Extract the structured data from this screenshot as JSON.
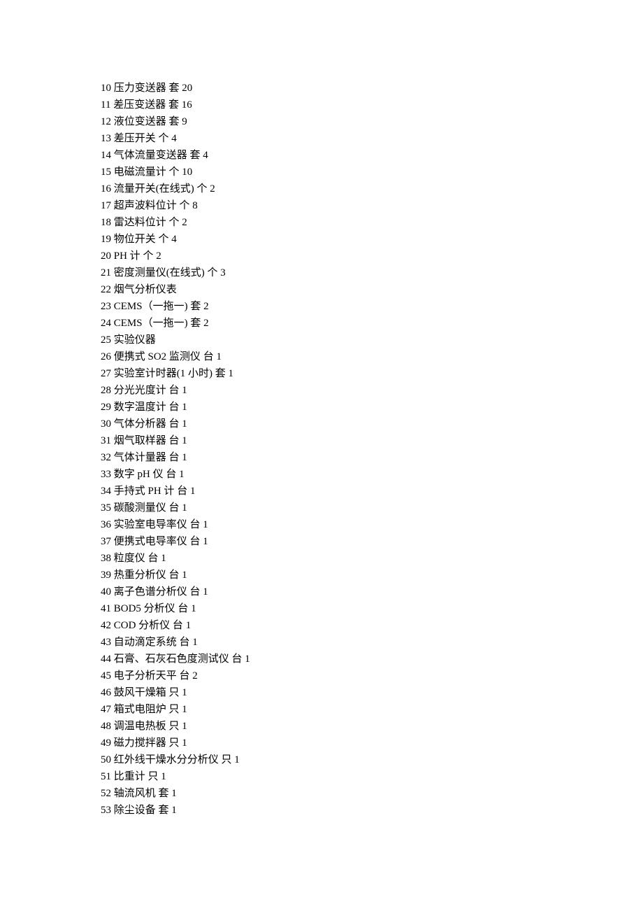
{
  "items": [
    {
      "num": "10",
      "name": "压力变送器",
      "unit": "套",
      "qty": "20"
    },
    {
      "num": "11",
      "name": "差压变送器",
      "unit": "套",
      "qty": "16"
    },
    {
      "num": "12",
      "name": "液位变送器",
      "unit": "套",
      "qty": "9"
    },
    {
      "num": "13",
      "name": "差压开关",
      "unit": "个",
      "qty": "4"
    },
    {
      "num": "14",
      "name": "气体流量变送器",
      "unit": "套",
      "qty": "4"
    },
    {
      "num": "15",
      "name": "电磁流量计",
      "unit": "个",
      "qty": "10"
    },
    {
      "num": "16",
      "name": "流量开关(在线式)",
      "unit": "个",
      "qty": "2"
    },
    {
      "num": "17",
      "name": "超声波料位计",
      "unit": "个",
      "qty": "8"
    },
    {
      "num": "18",
      "name": "雷达料位计",
      "unit": "个",
      "qty": "2"
    },
    {
      "num": "19",
      "name": "物位开关",
      "unit": "个",
      "qty": "4"
    },
    {
      "num": "20",
      "name": "PH 计",
      "unit": "个",
      "qty": "2"
    },
    {
      "num": "21",
      "name": "密度测量仪(在线式)",
      "unit": "个",
      "qty": "3"
    },
    {
      "num": "22",
      "name": "烟气分析仪表",
      "unit": "",
      "qty": ""
    },
    {
      "num": "23",
      "name": "CEMS（一拖一)",
      "unit": "套",
      "qty": "2"
    },
    {
      "num": "24",
      "name": "CEMS（一拖一)",
      "unit": "套",
      "qty": "2"
    },
    {
      "num": "25",
      "name": "实验仪器",
      "unit": "",
      "qty": ""
    },
    {
      "num": "26",
      "name": "便携式 SO2 监测仪",
      "unit": "台",
      "qty": "1"
    },
    {
      "num": "27",
      "name": "实验室计时器(1 小时)",
      "unit": "套",
      "qty": "1"
    },
    {
      "num": "28",
      "name": "分光光度计",
      "unit": "台",
      "qty": "1"
    },
    {
      "num": "29",
      "name": "数字温度计",
      "unit": "台",
      "qty": "1"
    },
    {
      "num": "30",
      "name": "气体分析器",
      "unit": "台",
      "qty": "1"
    },
    {
      "num": "31",
      "name": "烟气取样器",
      "unit": "台",
      "qty": "1"
    },
    {
      "num": "32",
      "name": "气体计量器",
      "unit": "台",
      "qty": "1"
    },
    {
      "num": "33",
      "name": "数字 pH 仪",
      "unit": "台",
      "qty": "1"
    },
    {
      "num": "34",
      "name": "手持式 PH 计",
      "unit": "台",
      "qty": "1"
    },
    {
      "num": "35",
      "name": "碳酸测量仪",
      "unit": "台",
      "qty": "1"
    },
    {
      "num": "36",
      "name": "实验室电导率仪",
      "unit": "台",
      "qty": "1"
    },
    {
      "num": "37",
      "name": "便携式电导率仪",
      "unit": "台",
      "qty": "1"
    },
    {
      "num": "38",
      "name": "粒度仪",
      "unit": "台",
      "qty": "1"
    },
    {
      "num": "39",
      "name": "热重分析仪",
      "unit": "台",
      "qty": "1"
    },
    {
      "num": "40",
      "name": "离子色谱分析仪",
      "unit": "台",
      "qty": "1"
    },
    {
      "num": "41",
      "name": "BOD5 分析仪",
      "unit": "台",
      "qty": "1"
    },
    {
      "num": "42",
      "name": "COD 分析仪",
      "unit": "台",
      "qty": "1"
    },
    {
      "num": "43",
      "name": "自动滴定系统",
      "unit": "台",
      "qty": "1"
    },
    {
      "num": "44",
      "name": "石膏、石灰石色度测试仪",
      "unit": "台",
      "qty": "1"
    },
    {
      "num": "45",
      "name": "电子分析天平",
      "unit": "台",
      "qty": "2"
    },
    {
      "num": "46",
      "name": "鼓风干燥箱",
      "unit": "只",
      "qty": "1"
    },
    {
      "num": "47",
      "name": "箱式电阻炉",
      "unit": "只",
      "qty": "1"
    },
    {
      "num": "48",
      "name": "调温电热板",
      "unit": "只",
      "qty": "1"
    },
    {
      "num": "49",
      "name": "磁力搅拌器",
      "unit": "只",
      "qty": "1"
    },
    {
      "num": "50",
      "name": "红外线干燥水分分析仪",
      "unit": "只",
      "qty": "1"
    },
    {
      "num": "51",
      "name": "比重计",
      "unit": "只",
      "qty": "1"
    },
    {
      "num": "52",
      "name": "轴流风机",
      "unit": "套",
      "qty": "1"
    },
    {
      "num": "53",
      "name": "除尘设备",
      "unit": "套",
      "qty": "1"
    }
  ]
}
